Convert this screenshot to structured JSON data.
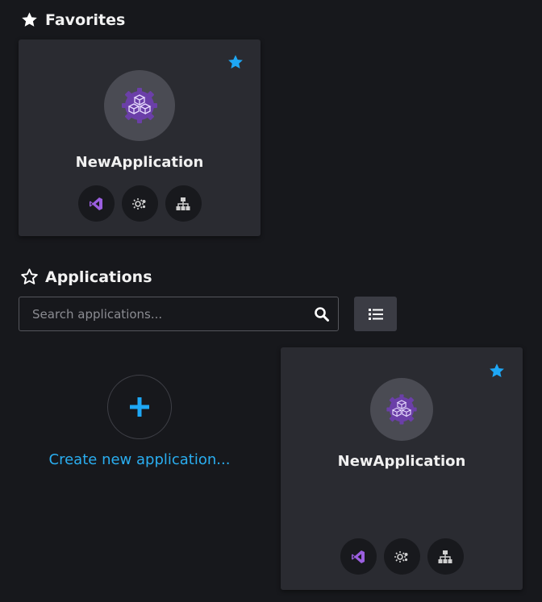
{
  "favorites": {
    "title": "Favorites",
    "card": {
      "app_name": "NewApplication",
      "favorited": true
    }
  },
  "applications": {
    "title": "Applications",
    "search": {
      "placeholder": "Search applications...",
      "value": ""
    },
    "create_label": "Create new application...",
    "cards": [
      {
        "app_name": "NewApplication",
        "favorited": true
      }
    ]
  },
  "icons": {
    "favorites_heading": "star-filled-icon",
    "applications_heading": "star-outline-icon",
    "favorite_toggle": "star-filled-icon",
    "app_avatar": "cubes-gear-icon",
    "tools": [
      "visual-studio-icon",
      "gear-settings-icon",
      "hierarchy-icon"
    ],
    "search": "search-icon",
    "list_view": "list-icon",
    "create": "plus-icon"
  },
  "colors": {
    "background": "#17181c",
    "card": "#2a2b31",
    "accent": "#1ea7f5",
    "link": "#2aaef0",
    "avatar_purple": "#6b3fa8"
  }
}
